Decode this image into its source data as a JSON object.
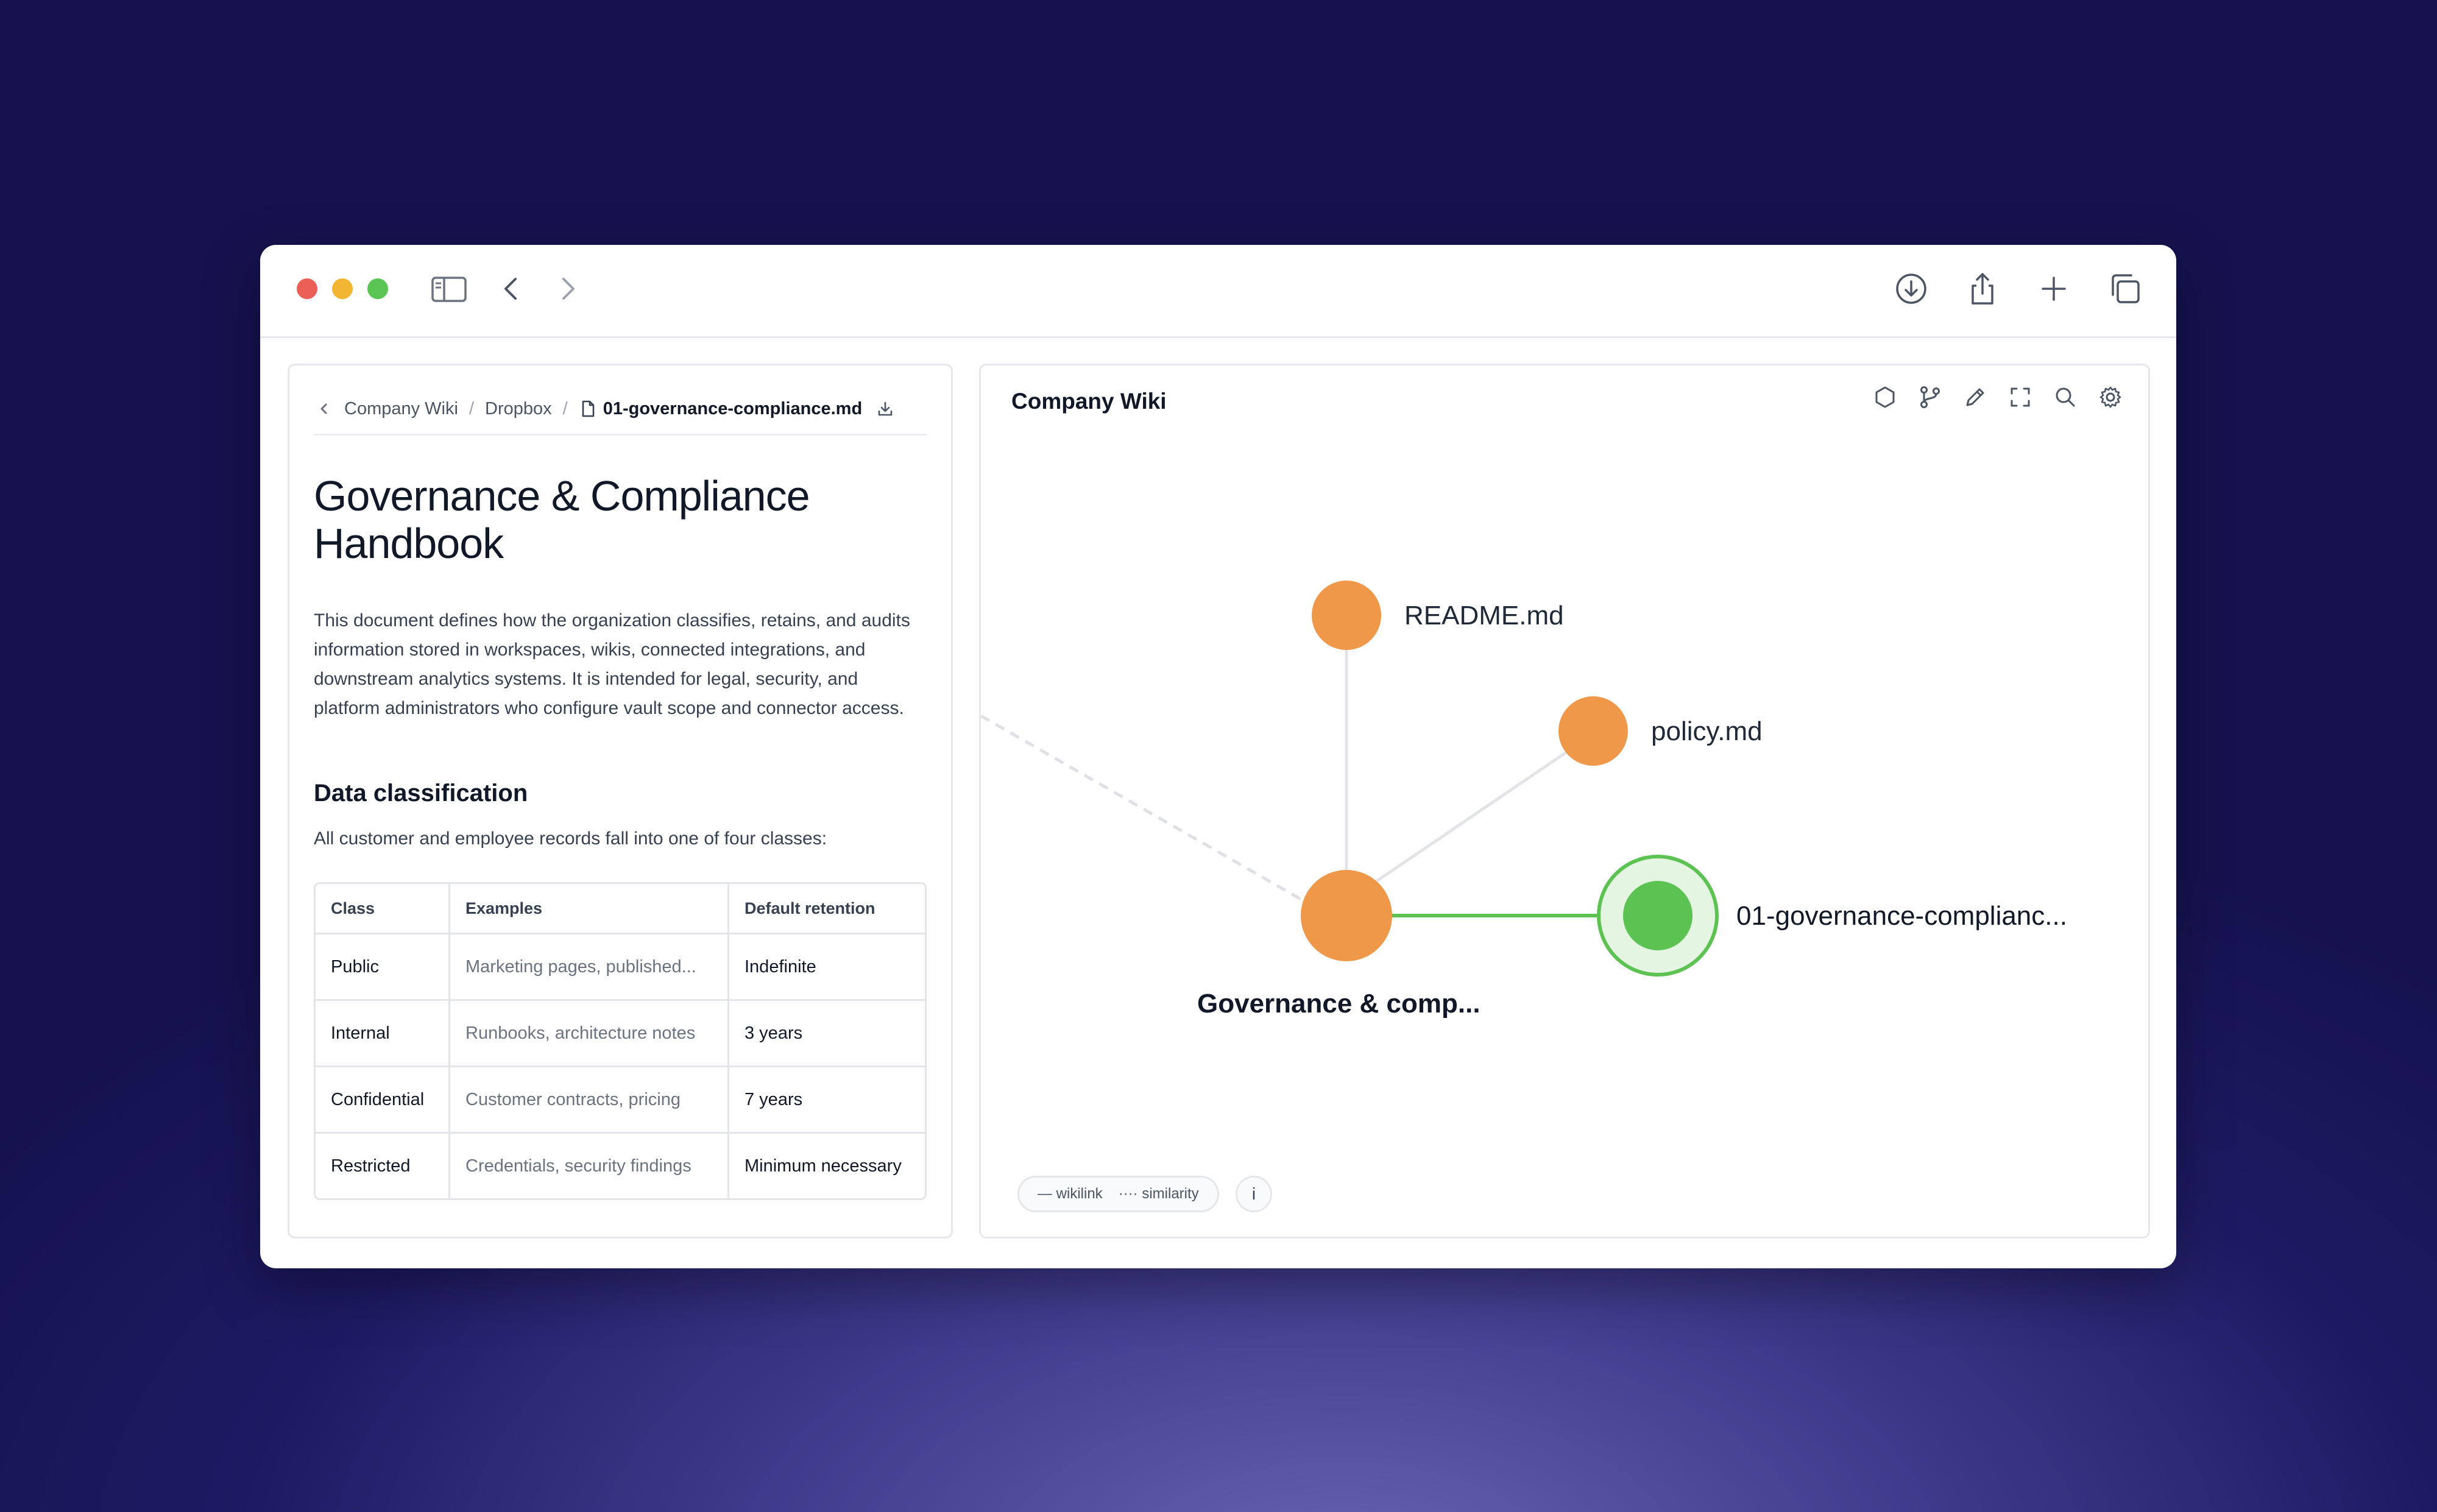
{
  "breadcrumb": {
    "root": "Company Wiki",
    "folder": "Dropbox",
    "file": "01-governance-compliance.md"
  },
  "document": {
    "title": "Governance & Compliance Handbook",
    "intro": "This document defines how the organization classifies, retains, and audits information stored in workspaces, wikis, connected integrations, and downstream analytics systems. It is intended for legal, security, and platform administrators who configure vault scope and connector access.",
    "section_heading": "Data classification",
    "section_para": "All customer and employee records fall into one of four classes:",
    "table": {
      "headers": [
        "Class",
        "Examples",
        "Default retention"
      ],
      "rows": [
        [
          "Public",
          "Marketing pages, published...",
          "Indefinite"
        ],
        [
          "Internal",
          "Runbooks, architecture notes",
          "3 years"
        ],
        [
          "Confidential",
          "Customer contracts, pricing",
          "7 years"
        ],
        [
          "Restricted",
          "Credentials, security findings",
          "Minimum necessary"
        ]
      ]
    }
  },
  "graph": {
    "title": "Company Wiki",
    "nodes": {
      "readme": "README.md",
      "policy": "policy.md",
      "governance": "Governance & comp...",
      "current": "01-governance-complianc..."
    },
    "legend": {
      "wikilink": "— wikilink",
      "similarity": "···· similarity"
    },
    "info": "i",
    "colors": {
      "node_orange": "#f0984a",
      "node_current": "#5cc252",
      "link_active": "#5cc252",
      "link_default": "#e2e4e8"
    }
  }
}
